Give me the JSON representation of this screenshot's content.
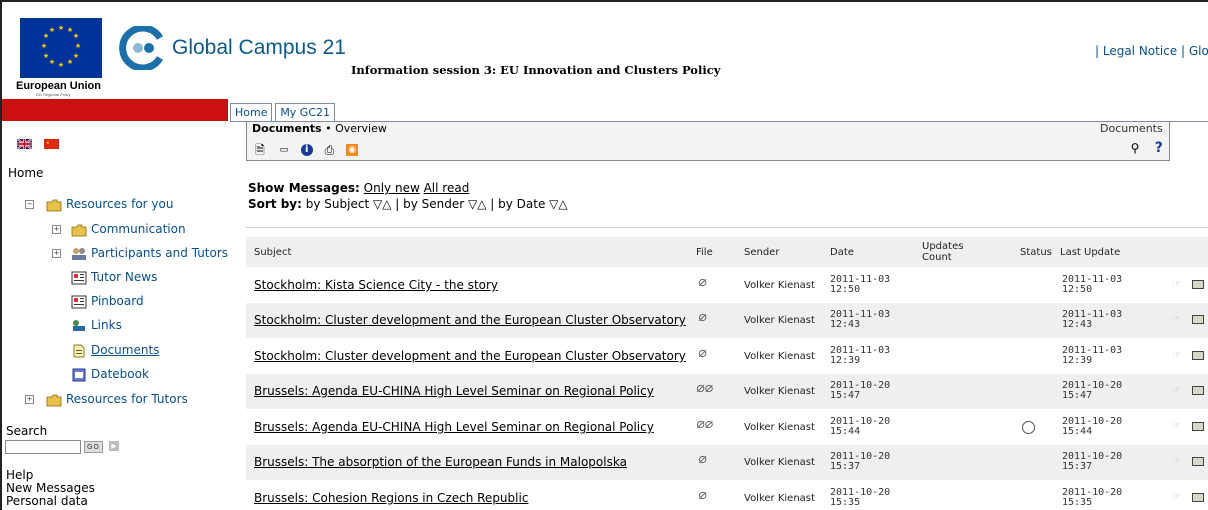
{
  "header": {
    "eu_label": "European Union",
    "eu_sublabel": "DG Regional Policy",
    "brand": "Global Campus 21",
    "session_title": "Information session 3: EU Innovation and Clusters Policy",
    "top_links": [
      "| Legal Notice",
      "| Globa"
    ]
  },
  "tabs": [
    "Home",
    "My GC21"
  ],
  "sidebar": {
    "home": "Home",
    "items": [
      {
        "label": "Resources for you",
        "expander": "⊟"
      },
      {
        "label": "Communication",
        "expander": "⊞"
      },
      {
        "label": "Participants and Tutors",
        "expander": "⊞"
      },
      {
        "label": "Tutor News"
      },
      {
        "label": "Pinboard"
      },
      {
        "label": "Links"
      },
      {
        "label": "Documents"
      },
      {
        "label": "Datebook"
      },
      {
        "label": "Resources for Tutors",
        "expander": "⊞"
      }
    ],
    "search_label": "Search",
    "search_go": "GO",
    "bottom_links": [
      "Help",
      "New Messages",
      "Personal data"
    ]
  },
  "docbar": {
    "title_bold": "Documents",
    "title_rest": " • Overview",
    "right_label": "Documents"
  },
  "filters": {
    "show_label": "Show Messages:",
    "only_new": "Only new",
    "all_read": "All read",
    "sort_label": "Sort by:",
    "sort_text": "by Subject ▽△ | by Sender ▽△ | by Date ▽△"
  },
  "table": {
    "headers": {
      "subject": "Subject",
      "file": "File",
      "sender": "Sender",
      "date": "Date",
      "updates": "Updates Count",
      "status": "Status",
      "last_update": "Last Update"
    },
    "rows": [
      {
        "subject": "Stockholm: Kista Science City - the story",
        "files": 1,
        "sender": "Volker Kienast",
        "date": "2011-11-03",
        "time": "12:50",
        "status": false,
        "last_date": "2011-11-03",
        "last_time": "12:50"
      },
      {
        "subject": "Stockholm: Cluster development and the European Cluster Observatory",
        "files": 1,
        "sender": "Volker Kienast",
        "date": "2011-11-03",
        "time": "12:43",
        "status": false,
        "last_date": "2011-11-03",
        "last_time": "12:43"
      },
      {
        "subject": "Stockholm: Cluster development and the European Cluster Observatory",
        "files": 1,
        "sender": "Volker Kienast",
        "date": "2011-11-03",
        "time": "12:39",
        "status": false,
        "last_date": "2011-11-03",
        "last_time": "12:39"
      },
      {
        "subject": "Brussels: Agenda EU-CHINA High Level Seminar on Regional Policy",
        "files": 2,
        "sender": "Volker Kienast",
        "date": "2011-10-20",
        "time": "15:47",
        "status": false,
        "last_date": "2011-10-20",
        "last_time": "15:47"
      },
      {
        "subject": "Brussels: Agenda EU-CHINA High Level Seminar on Regional Policy",
        "files": 2,
        "sender": "Volker Kienast",
        "date": "2011-10-20",
        "time": "15:44",
        "status": true,
        "last_date": "2011-10-20",
        "last_time": "15:44"
      },
      {
        "subject": "Brussels: The absorption of the European Funds in Malopolska",
        "files": 1,
        "sender": "Volker Kienast",
        "date": "2011-10-20",
        "time": "15:37",
        "status": false,
        "last_date": "2011-10-20",
        "last_time": "15:37"
      },
      {
        "subject": "Brussels: Cohesion Regions in Czech Republic",
        "files": 1,
        "sender": "Volker Kienast",
        "date": "2011-10-20",
        "time": "15:35",
        "status": false,
        "last_date": "2011-10-20",
        "last_time": "15:35"
      }
    ]
  },
  "colors": {
    "brand_blue": "#0a5a8a",
    "eu_blue": "#003399",
    "eu_star": "#ffcc00",
    "red_bar": "#cc1010"
  }
}
